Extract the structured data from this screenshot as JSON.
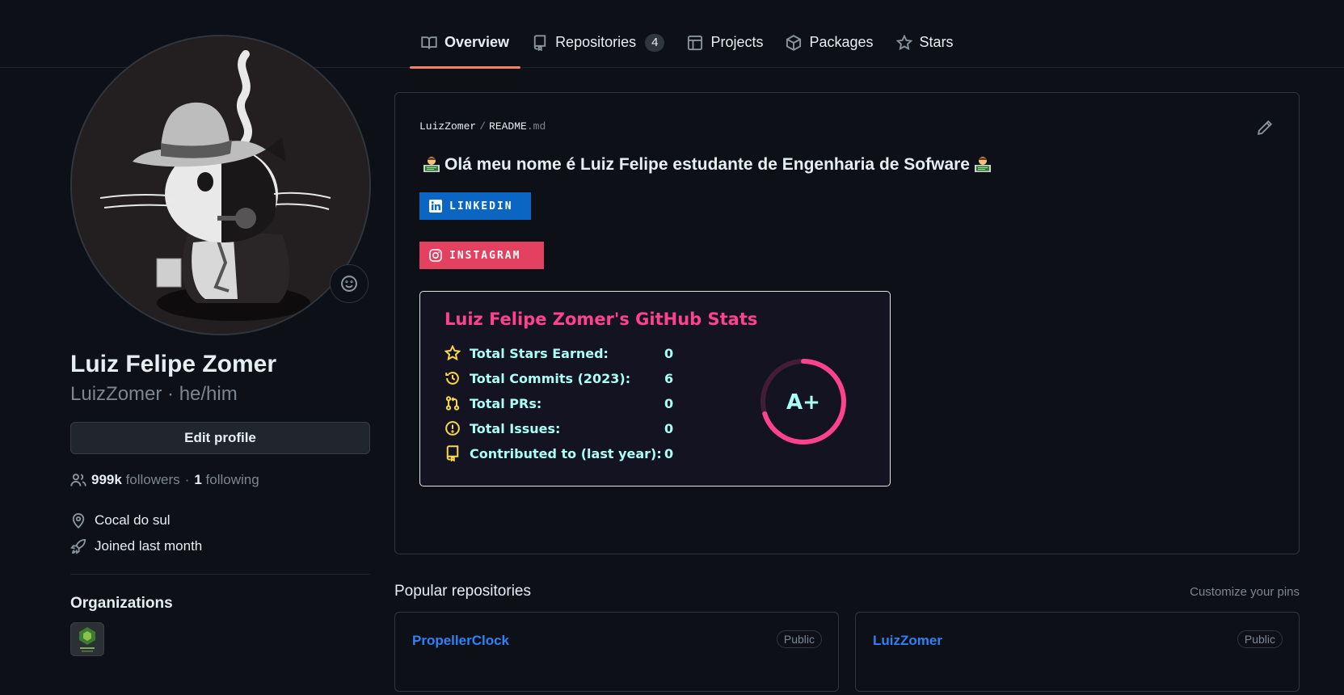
{
  "tabs": [
    {
      "label": "Overview",
      "icon": "book-icon",
      "active": true
    },
    {
      "label": "Repositories",
      "icon": "repo-icon",
      "count": "4"
    },
    {
      "label": "Projects",
      "icon": "table-icon"
    },
    {
      "label": "Packages",
      "icon": "package-icon"
    },
    {
      "label": "Stars",
      "icon": "star-icon"
    }
  ],
  "profile": {
    "name": "Luiz Felipe Zomer",
    "login_line": "LuizZomer · he/him",
    "edit_label": "Edit profile",
    "followers_count": "999k",
    "followers_label": "followers",
    "dot": "·",
    "following_count": "1",
    "following_label": "following",
    "location": "Cocal do sul",
    "joined": "Joined last month",
    "organizations_title": "Organizations"
  },
  "readme": {
    "path_user": "LuizZomer",
    "path_sep": "/",
    "path_file": "README",
    "path_ext": ".md",
    "heading": "Olá meu nome é Luiz Felipe estudante de Engenharia de Sofware",
    "badges": {
      "linkedin": "LINKEDIN",
      "instagram": "INSTAGRAM"
    },
    "badge_colors": {
      "linkedin": "#0a66c2",
      "instagram": "#e4405f"
    }
  },
  "stats": {
    "title": "Luiz Felipe Zomer's GitHub Stats",
    "rows": [
      {
        "label": "Total Stars Earned:",
        "value": "0",
        "icon": "star-icon"
      },
      {
        "label": "Total Commits (2023):",
        "value": "6",
        "icon": "history-icon"
      },
      {
        "label": "Total PRs:",
        "value": "0",
        "icon": "pull-request-icon"
      },
      {
        "label": "Total Issues:",
        "value": "0",
        "icon": "issue-icon"
      },
      {
        "label": "Contributed to (last year):",
        "value": "0",
        "icon": "repo-icon"
      }
    ],
    "rank": "A+",
    "rank_progress": 0.7,
    "colors": {
      "title": "#fe428e",
      "text": "#a9fef7",
      "icon": "#f8d847",
      "ring": "#fe428e",
      "bg": "#141321"
    }
  },
  "popular": {
    "title": "Popular repositories",
    "customize": "Customize your pins",
    "repos": [
      {
        "name": "PropellerClock",
        "visibility": "Public"
      },
      {
        "name": "LuizZomer",
        "visibility": "Public"
      }
    ]
  }
}
